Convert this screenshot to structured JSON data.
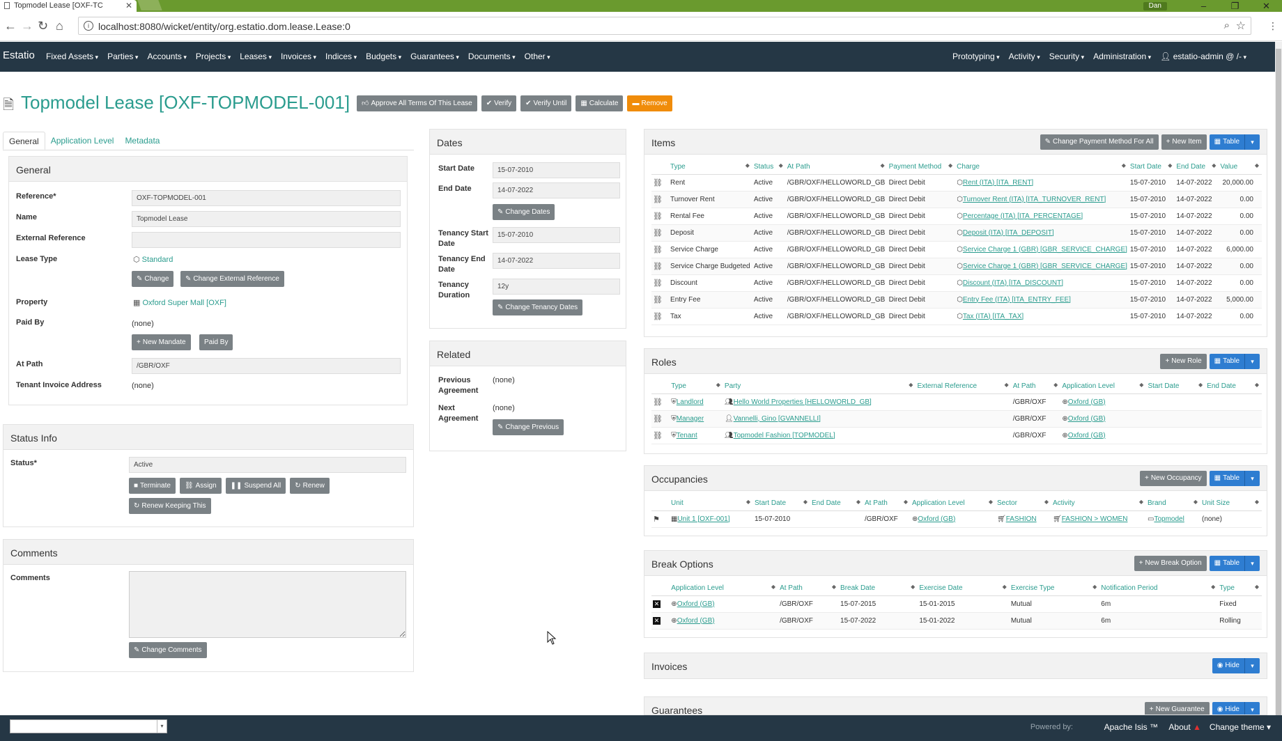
{
  "browser": {
    "tab_title": "Topmodel Lease [OXF-TC",
    "url": "localhost:8080/wicket/entity/org.estatio.dom.lease.Lease:0",
    "user_badge": "Dan"
  },
  "nav": {
    "brand": "Estatio",
    "left_menus": [
      "Fixed Assets",
      "Parties",
      "Accounts",
      "Projects",
      "Leases",
      "Invoices",
      "Indices",
      "Budgets",
      "Guarantees",
      "Documents",
      "Other"
    ],
    "right_menus": [
      "Prototyping",
      "Activity",
      "Security",
      "Administration",
      "estatio-admin @ /-"
    ]
  },
  "title": "Topmodel Lease [OXF-TOPMODEL-001]",
  "actions": [
    "Approve All Terms Of This Lease",
    "Verify",
    "Verify Until",
    "Calculate",
    "Remove"
  ],
  "tabs": [
    "General",
    "Application Level",
    "Metadata"
  ],
  "general": {
    "header": "General",
    "reference_label": "Reference*",
    "reference": "OXF-TOPMODEL-001",
    "name_label": "Name",
    "name": "Topmodel Lease",
    "extref_label": "External Reference",
    "extref": "",
    "leasetype_label": "Lease Type",
    "leasetype": "Standard",
    "change_btn": "Change",
    "change_extref_btn": "Change External Reference",
    "property_label": "Property",
    "property": "Oxford Super Mall [OXF]",
    "paidby_label": "Paid By",
    "paidby": "(none)",
    "new_mandate_btn": "New Mandate",
    "paidby_btn": "Paid By",
    "atpath_label": "At Path",
    "atpath": "/GBR/OXF",
    "tenant_invoice_label": "Tenant Invoice Address",
    "tenant_invoice": "(none)"
  },
  "status": {
    "header": "Status Info",
    "status_label": "Status*",
    "status": "Active",
    "buttons": [
      "Terminate",
      "Assign",
      "Suspend All",
      "Renew"
    ],
    "renew_keep_btn": "Renew Keeping This"
  },
  "comments": {
    "header": "Comments",
    "label": "Comments",
    "value": "",
    "change_btn": "Change Comments"
  },
  "dates": {
    "header": "Dates",
    "start_label": "Start Date",
    "start": "15-07-2010",
    "end_label": "End Date",
    "end": "14-07-2022",
    "change_dates_btn": "Change Dates",
    "tstart_label": "Tenancy Start Date",
    "tstart": "15-07-2010",
    "tend_label": "Tenancy End Date",
    "tend": "14-07-2022",
    "tdur_label": "Tenancy Duration",
    "tdur": "12y",
    "change_tenancy_btn": "Change Tenancy Dates"
  },
  "related": {
    "header": "Related",
    "prev_label": "Previous Agreement",
    "prev": "(none)",
    "next_label": "Next Agreement",
    "next": "(none)",
    "change_prev_btn": "Change Previous"
  },
  "items": {
    "header": "Items",
    "btn_change_payment": "Change Payment Method For All",
    "btn_new": "New Item",
    "btn_table": "Table",
    "columns": [
      "Type",
      "Status",
      "At Path",
      "Payment Method",
      "Charge",
      "Start Date",
      "End Date",
      "Value"
    ],
    "rows": [
      [
        "Rent",
        "Active",
        "/GBR/OXF/HELLOWORLD_GB",
        "Direct Debit",
        "Rent (ITA) [ITA_RENT]",
        "15-07-2010",
        "14-07-2022",
        "20,000.00"
      ],
      [
        "Turnover Rent",
        "Active",
        "/GBR/OXF/HELLOWORLD_GB",
        "Direct Debit",
        "Turnover Rent (ITA) [ITA_TURNOVER_RENT]",
        "15-07-2010",
        "14-07-2022",
        "0.00"
      ],
      [
        "Rental Fee",
        "Active",
        "/GBR/OXF/HELLOWORLD_GB",
        "Direct Debit",
        "Percentage (ITA) [ITA_PERCENTAGE]",
        "15-07-2010",
        "14-07-2022",
        "0.00"
      ],
      [
        "Deposit",
        "Active",
        "/GBR/OXF/HELLOWORLD_GB",
        "Direct Debit",
        "Deposit (ITA) [ITA_DEPOSIT]",
        "15-07-2010",
        "14-07-2022",
        "0.00"
      ],
      [
        "Service Charge",
        "Active",
        "/GBR/OXF/HELLOWORLD_GB",
        "Direct Debit",
        "Service Charge 1 (GBR) [GBR_SERVICE_CHARGE]",
        "15-07-2010",
        "14-07-2022",
        "6,000.00"
      ],
      [
        "Service Charge Budgeted",
        "Active",
        "/GBR/OXF/HELLOWORLD_GB",
        "Direct Debit",
        "Service Charge 1 (GBR) [GBR_SERVICE_CHARGE]",
        "15-07-2010",
        "14-07-2022",
        "0.00"
      ],
      [
        "Discount",
        "Active",
        "/GBR/OXF/HELLOWORLD_GB",
        "Direct Debit",
        "Discount (ITA) [ITA_DISCOUNT]",
        "15-07-2010",
        "14-07-2022",
        "0.00"
      ],
      [
        "Entry Fee",
        "Active",
        "/GBR/OXF/HELLOWORLD_GB",
        "Direct Debit",
        "Entry Fee (ITA) [ITA_ENTRY_FEE]",
        "15-07-2010",
        "14-07-2022",
        "5,000.00"
      ],
      [
        "Tax",
        "Active",
        "/GBR/OXF/HELLOWORLD_GB",
        "Direct Debit",
        "Tax (ITA) [ITA_TAX]",
        "15-07-2010",
        "14-07-2022",
        "0.00"
      ]
    ]
  },
  "roles": {
    "header": "Roles",
    "btn_new": "New Role",
    "btn_table": "Table",
    "columns": [
      "Type",
      "Party",
      "External Reference",
      "At Path",
      "Application Level",
      "Start Date",
      "End Date"
    ],
    "rows": [
      [
        "Landlord",
        "Hello World Properties [HELLOWORLD_GB]",
        "",
        "/GBR/OXF",
        "Oxford (GB)",
        "",
        ""
      ],
      [
        "Manager",
        "Vannelli, Gino [GVANNELLI]",
        "",
        "/GBR/OXF",
        "Oxford (GB)",
        "",
        ""
      ],
      [
        "Tenant",
        "Topmodel Fashion [TOPMODEL]",
        "",
        "/GBR/OXF",
        "Oxford (GB)",
        "",
        ""
      ]
    ]
  },
  "occupancies": {
    "header": "Occupancies",
    "btn_new": "New Occupancy",
    "btn_table": "Table",
    "columns": [
      "Unit",
      "Start Date",
      "End Date",
      "At Path",
      "Application Level",
      "Sector",
      "Activity",
      "Brand",
      "Unit Size"
    ],
    "rows": [
      [
        "Unit 1 [OXF-001]",
        "15-07-2010",
        "",
        "/GBR/OXF",
        "Oxford (GB)",
        "FASHION",
        "FASHION > WOMEN",
        "Topmodel",
        "(none)"
      ]
    ]
  },
  "breaks": {
    "header": "Break Options",
    "btn_new": "New Break Option",
    "btn_table": "Table",
    "columns": [
      "Application Level",
      "At Path",
      "Break Date",
      "Exercise Date",
      "Exercise Type",
      "Notification Period",
      "Type"
    ],
    "rows": [
      [
        "Oxford (GB)",
        "/GBR/OXF",
        "15-07-2015",
        "15-01-2015",
        "Mutual",
        "6m",
        "Fixed"
      ],
      [
        "Oxford (GB)",
        "/GBR/OXF",
        "15-07-2022",
        "15-01-2022",
        "Mutual",
        "6m",
        "Rolling"
      ]
    ]
  },
  "invoices": {
    "header": "Invoices",
    "btn_hide": "Hide"
  },
  "guarantees": {
    "header": "Guarantees",
    "btn_new": "New Guarantee",
    "btn_hide": "Hide"
  },
  "footer": {
    "powered": "Powered by:",
    "isis": "Apache Isis ™",
    "about": "About",
    "theme": "Change theme"
  },
  "colors": {
    "accent": "#2a9c8e",
    "navbar": "#253745",
    "remove": "#f08c0a",
    "table_btn": "#2e7dd1"
  }
}
